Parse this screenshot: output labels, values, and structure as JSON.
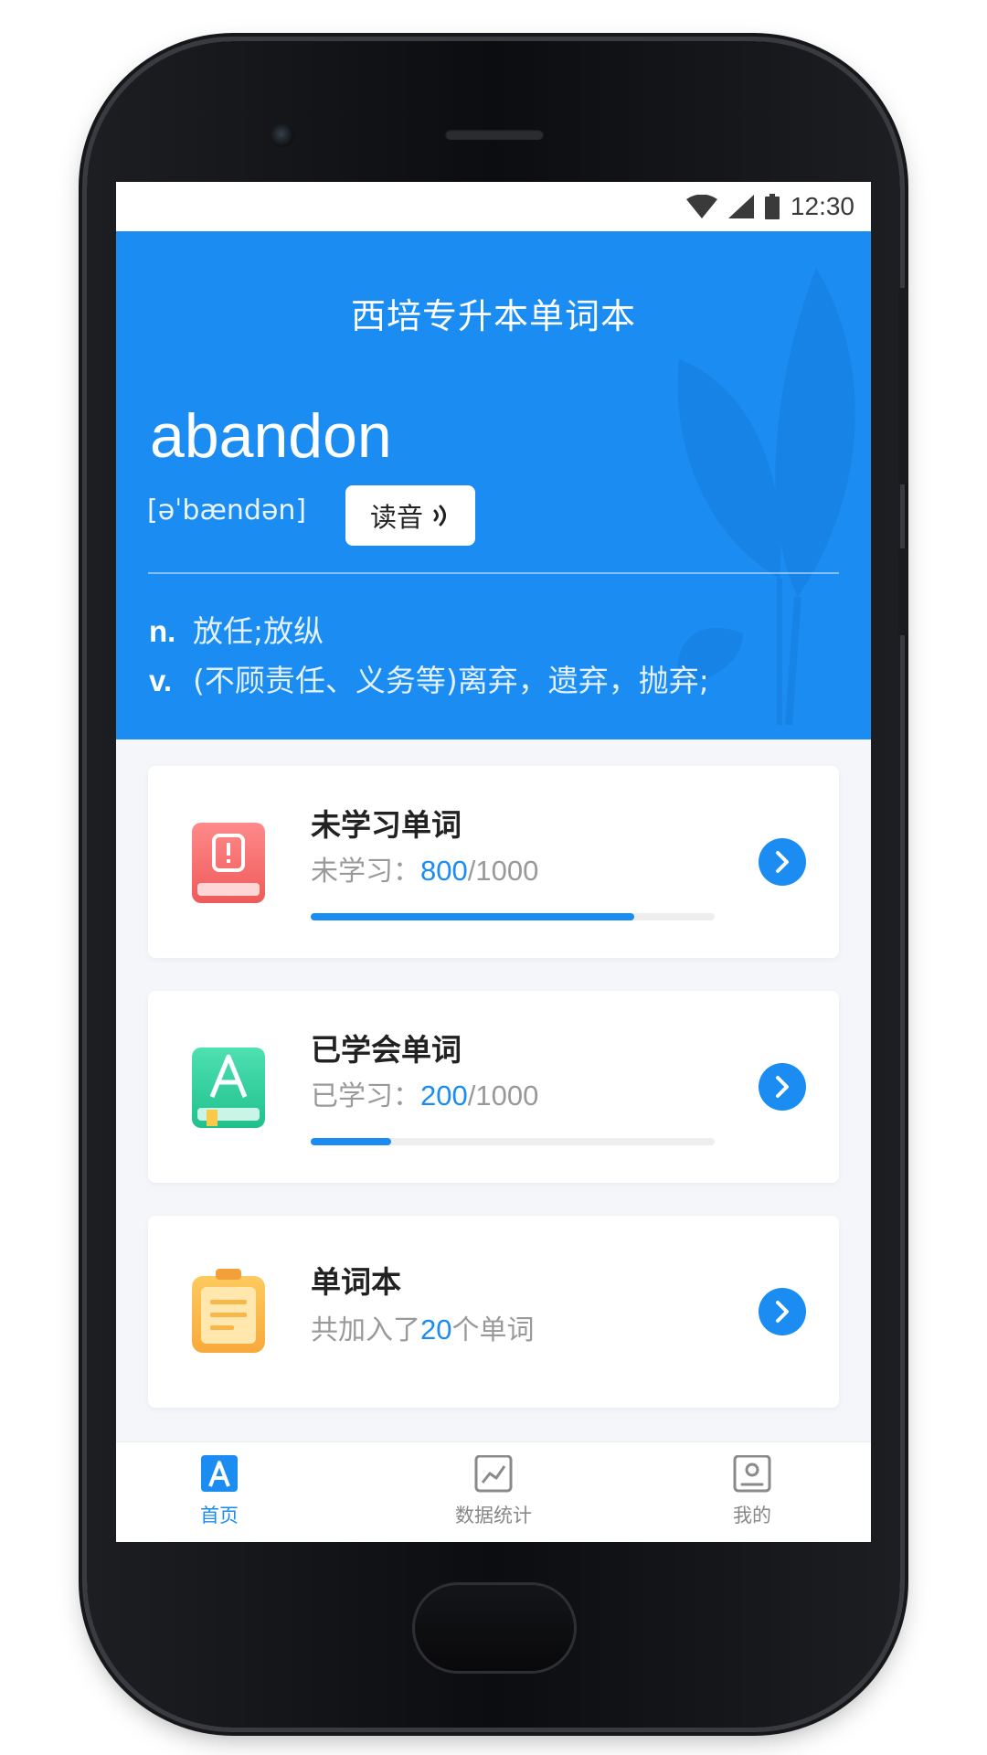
{
  "status_bar": {
    "time": "12:30"
  },
  "header": {
    "app_title": "西培专升本单词本",
    "word": "abandon",
    "phonetic": "[əˈbændən]",
    "read_button_label": "读音",
    "meanings": [
      {
        "pos": "n.",
        "definition": "放任;放纵"
      },
      {
        "pos": "v.",
        "definition": "(不顾责任、义务等)离弃，遗弃，抛弃;"
      }
    ]
  },
  "cards": [
    {
      "title": "未学习单词",
      "subtitle_prefix": "未学习：",
      "count": "800",
      "total": "/1000",
      "progress": 0.8,
      "icon": "red-book-alert-icon"
    },
    {
      "title": "已学会单词",
      "subtitle_prefix": "已学习：",
      "count": "200",
      "total": "/1000",
      "progress": 0.2,
      "icon": "green-book-letter-a-icon"
    },
    {
      "title": "单词本",
      "subtitle_prefix": "共加入了",
      "count": "20",
      "suffix": "个单词",
      "icon": "yellow-clipboard-icon"
    }
  ],
  "tabbar": {
    "tabs": [
      {
        "label": "首页",
        "active": true,
        "icon": "home-letter-a-icon"
      },
      {
        "label": "数据统计",
        "active": false,
        "icon": "chart-icon"
      },
      {
        "label": "我的",
        "active": false,
        "icon": "profile-icon"
      }
    ]
  },
  "colors": {
    "primary": "#1a8cf2",
    "background": "#f4f6f9",
    "card_red": "#f26b6b",
    "card_green": "#2ecf9d",
    "card_yellow": "#fbb84a"
  }
}
